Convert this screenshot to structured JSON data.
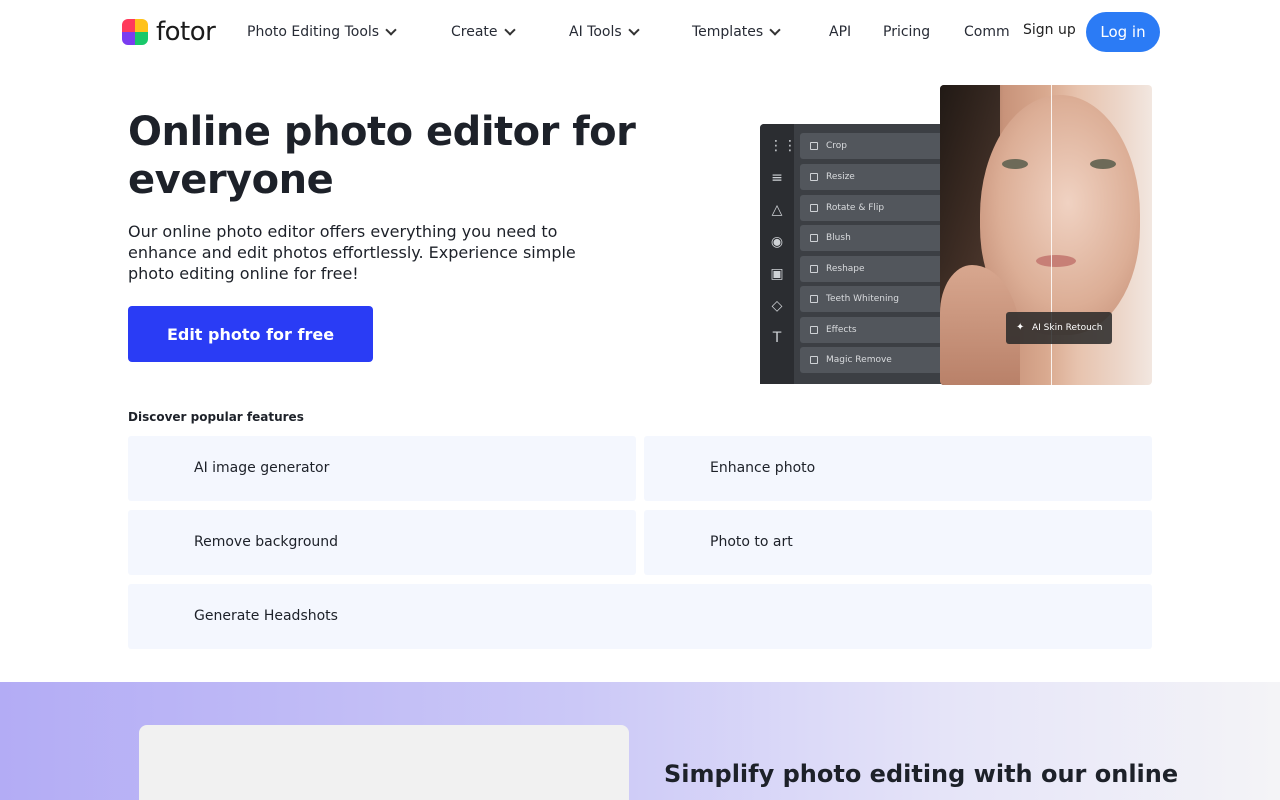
{
  "header": {
    "logo_text": "fotor",
    "nav": [
      {
        "label": "Photo Editing Tools",
        "has_dropdown": true
      },
      {
        "label": "Create",
        "has_dropdown": true
      },
      {
        "label": "AI Tools",
        "has_dropdown": true
      },
      {
        "label": "Templates",
        "has_dropdown": true
      },
      {
        "label": "API",
        "has_dropdown": false
      },
      {
        "label": "Pricing",
        "has_dropdown": false
      },
      {
        "label": "Comm",
        "has_dropdown": false
      }
    ],
    "signup_label": "Sign up",
    "login_label": "Log in"
  },
  "hero": {
    "title": "Online photo editor for everyone",
    "description": "Our online photo editor offers everything you need to enhance and edit photos effortlessly. Experience simple photo editing online for free!",
    "cta_label": "Edit photo for free",
    "editor_tools": [
      "Crop",
      "Resize",
      "Rotate & Flip",
      "Blush",
      "Reshape",
      "Teeth Whitening",
      "Effects",
      "Magic Remove"
    ],
    "retouch_label": "AI Skin Retouch"
  },
  "features": {
    "heading": "Discover popular features",
    "items": [
      "AI image generator",
      "Enhance photo",
      "Remove background",
      "Photo to art",
      "Generate Headshots"
    ]
  },
  "banner": {
    "title": "Simplify photo editing with our online"
  },
  "colors": {
    "primary_button": "#2a3cf5",
    "login_button": "#2b7bf5",
    "feature_bg": "#f4f7fe"
  }
}
